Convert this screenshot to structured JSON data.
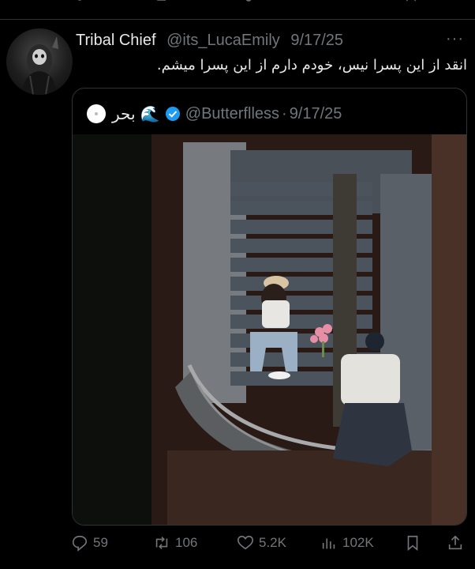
{
  "tweet": {
    "author_name": "Tribal Chief",
    "handle": "@its_LucaEmily",
    "date": "9/17/25",
    "more_label": "···",
    "text": "انقد از این پسرا نیس، خودم دارم از این پسرا میشم."
  },
  "quoted": {
    "name": "بحر 🌊",
    "handle": "@Butterflless",
    "separator": "·",
    "date": "9/17/25"
  },
  "actions": {
    "replies": "59",
    "reposts": "106",
    "likes": "5.2K",
    "views": "102K"
  },
  "colors": {
    "background": "#000000",
    "text_primary": "#e7e9ea",
    "text_secondary": "#71767b",
    "verified_blue": "#1d9bf0",
    "border": "#2f3336"
  },
  "icons": [
    "reply-icon",
    "retweet-icon",
    "like-icon",
    "views-icon",
    "bookmark-icon",
    "share-icon",
    "verified-badge-icon",
    "more-icon"
  ]
}
